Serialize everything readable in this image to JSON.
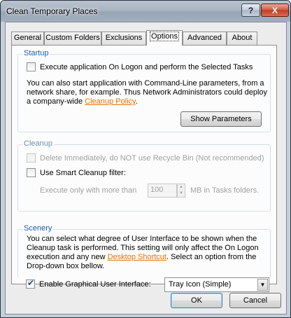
{
  "window": {
    "title": "Clean Temporary Places",
    "help_label": "?",
    "close_label": "X"
  },
  "tabs": [
    {
      "label": "General"
    },
    {
      "label": "Custom Folders"
    },
    {
      "label": "Exclusions"
    },
    {
      "label": "Options",
      "active": true
    },
    {
      "label": "Advanced"
    },
    {
      "label": "About"
    }
  ],
  "startup": {
    "label": "Startup",
    "checkbox_label": "Execute application On Logon and perform the Selected Tasks",
    "checkbox_checked": false,
    "text_before_link": "You can also start application with Command-Line parameters, from a network share, for example. Thus Network Administrators could deploy a company-wide ",
    "link": "Cleanup Policy",
    "text_after_link": ".",
    "button": "Show Parameters"
  },
  "cleanup": {
    "label": "Cleanup",
    "delete_label": "Delete Immediately, do NOT use Recycle Bin (Not recommended)",
    "delete_checked": false,
    "smart_label": "Use Smart Cleanup filter:",
    "smart_checked": false,
    "execute_prefix": "Execute only with more than",
    "execute_value": "100",
    "execute_suffix": "MB in Tasks folders."
  },
  "scenery": {
    "label": "Scenery",
    "text_before_link": "You can select what degree of User Interface to be shown when the Cleanup task is performed. This setting will only affect the On Logon execution and any new ",
    "link": "Desktop Shortcut",
    "text_after_link": ". Select an option from the Drop-down box bellow.",
    "gui_label": "Enable Graphical User Interface:",
    "gui_checked": true,
    "dropdown_value": "Tray Icon (Simple)"
  },
  "footer": {
    "ok": "OK",
    "cancel": "Cancel"
  }
}
